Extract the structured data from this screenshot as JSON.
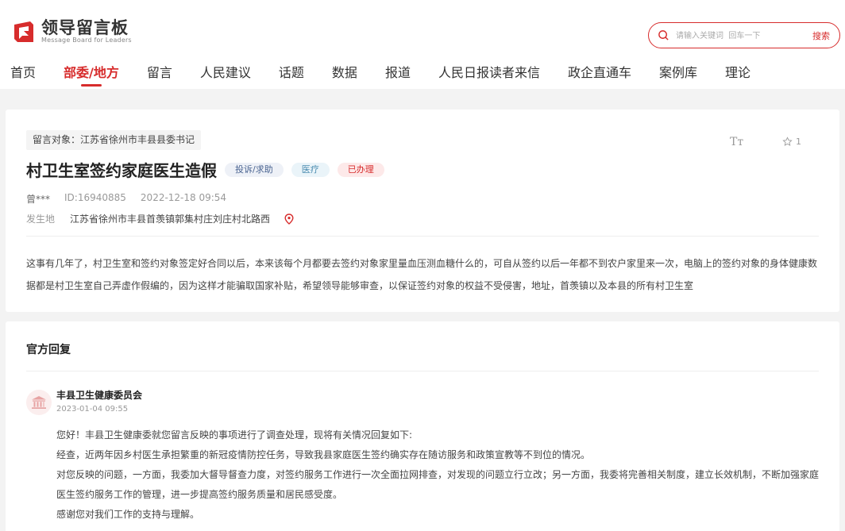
{
  "header": {
    "logo_cn": "领导留言板",
    "logo_en": "Message Board for Leaders",
    "search": {
      "placeholder": "请输入关键词  回车一下",
      "button_label": "搜索"
    }
  },
  "nav": {
    "items": [
      "首页",
      "部委/地方",
      "留言",
      "人民建议",
      "话题",
      "数据",
      "报道",
      "人民日报读者来信",
      "政企直通车",
      "案例库",
      "理论"
    ],
    "active_index": 1
  },
  "message": {
    "target": "留言对象：江苏省徐州市丰县县委书记",
    "title": "村卫生室签约家庭医生造假",
    "tags": [
      "投诉/求助",
      "医疗",
      "已办理"
    ],
    "font_toggle": "Tт",
    "favorite_count": "1",
    "author": "曾***",
    "id_text": "ID:16940885",
    "datetime": "2022-12-18 09:54",
    "location_label": "发生地",
    "location": "江苏省徐州市丰县首羡镇郭集村庄刘庄村北路西",
    "body": "这事有几年了，村卫生室和签约对象签定好合同以后，本来该每个月都要去签约对象家里量血压测血糖什么的，可自从签约以后一年都不到农户家里来一次，电脑上的签约对象的身体健康数据都是村卫生室自己弄虚作假编的，因为这样才能骗取国家补贴，希望领导能够审查，以保证签约对象的权益不受侵害，地址，首羡镇以及本县的所有村卫生室"
  },
  "reply": {
    "heading": "官方回复",
    "org_name": "丰县卫生健康委员会",
    "date": "2023-01-04 09:55",
    "paragraphs": [
      "您好！丰县卫生健康委就您留言反映的事项进行了调查处理，现将有关情况回复如下:",
      "经查，近两年因乡村医生承担繁重的新冠疫情防控任务，导致我县家庭医生签约确实存在随访服务和政策宣教等不到位的情况。",
      "对您反映的问题，一方面，我委加大督导督查力度，对签约服务工作进行一次全面拉网排查，对发现的问题立行立改；另一方面，我委将完善相关制度，建立长效机制，不断加强家庭医生签约服务工作的管理，进一步提高签约服务质量和居民感受度。",
      "感谢您对我们工作的支持与理解。"
    ]
  },
  "colors": {
    "accent": "#d72c2c",
    "background": "#f3f3f3"
  }
}
